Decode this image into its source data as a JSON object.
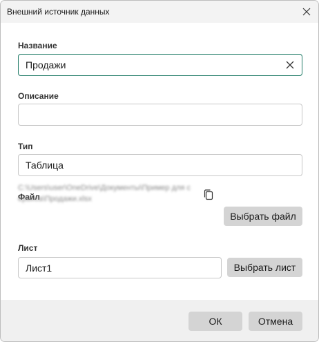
{
  "window": {
    "title": "Внешний источник данных"
  },
  "form": {
    "name_label": "Название",
    "name_value": "Продажи",
    "description_label": "Описание",
    "description_value": "",
    "type_label": "Тип",
    "type_value": "Таблица",
    "file_label": "Файл",
    "file_path": "C:\\Users\\user\\OneDrive\\Документы\\Пример для сервиса\\Продажи.xlsx",
    "choose_file_label": "Выбрать файл",
    "sheet_label": "Лист",
    "sheet_value": "Лист1",
    "choose_sheet_label": "Выбрать лист"
  },
  "footer": {
    "ok_label": "ОК",
    "cancel_label": "Отмена"
  },
  "colors": {
    "focus_border": "#1f7a66",
    "button_bg": "#d4d4d4",
    "footer_bg": "#f0f0f0"
  },
  "icons": {
    "close": "close-icon",
    "clear": "clear-icon",
    "copy": "copy-icon"
  }
}
